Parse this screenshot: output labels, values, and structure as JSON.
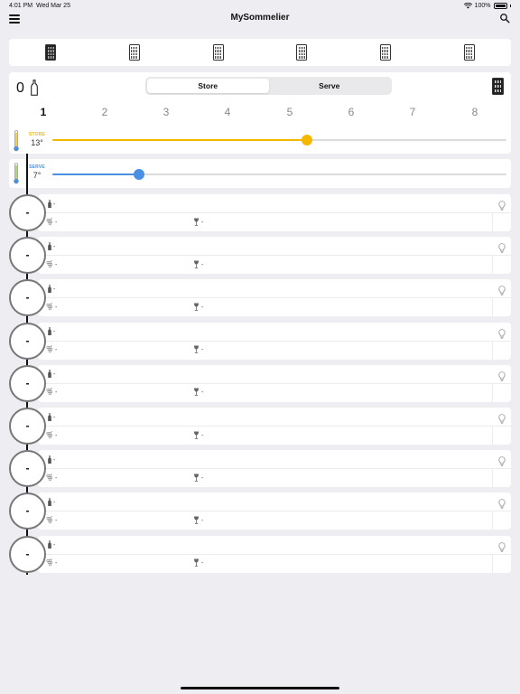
{
  "status_bar": {
    "time": "4:01 PM",
    "date": "Wed Mar 25",
    "battery": "100%"
  },
  "navbar": {
    "title": "MySommelier",
    "menu_icon": "hamburger-icon",
    "search_icon": "search-icon"
  },
  "fridges": {
    "count": 6,
    "active_index": 0
  },
  "cellar": {
    "bottle_count": "0",
    "tabs": [
      "Store",
      "Serve"
    ],
    "active_tab": "Store"
  },
  "zones": {
    "labels": [
      "1",
      "2",
      "3",
      "4",
      "5",
      "6",
      "7",
      "8"
    ],
    "active": "1"
  },
  "store_temp": {
    "label": "STORE",
    "value": "13°",
    "level": 0.56,
    "color": "#f5b800"
  },
  "serve_temp": {
    "label": "SERVE",
    "value": "7°",
    "level": 0.19,
    "color": "#4a90e2"
  },
  "slots": [
    {
      "position": "-",
      "name": "-",
      "grape": "-",
      "glass": "-"
    },
    {
      "position": "-",
      "name": "-",
      "grape": "-",
      "glass": "-"
    },
    {
      "position": "-",
      "name": "-",
      "grape": "-",
      "glass": "-"
    },
    {
      "position": "-",
      "name": "-",
      "grape": "-",
      "glass": "-"
    },
    {
      "position": "-",
      "name": "-",
      "grape": "-",
      "glass": "-"
    },
    {
      "position": "-",
      "name": "-",
      "grape": "-",
      "glass": "-"
    },
    {
      "position": "-",
      "name": "-",
      "grape": "-",
      "glass": "-"
    },
    {
      "position": "-",
      "name": "-",
      "grape": "-",
      "glass": "-"
    },
    {
      "position": "-",
      "name": "-",
      "grape": "-",
      "glass": "-"
    }
  ]
}
